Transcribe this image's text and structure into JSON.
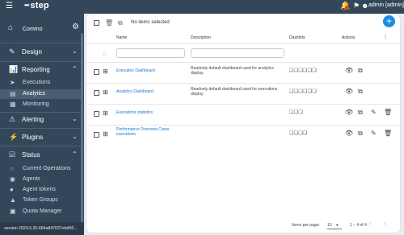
{
  "topbar": {
    "menu_icon": "menu-icon",
    "logo_dots": "•••",
    "logo_text": "step",
    "user_label": "admin [admin]"
  },
  "sidebar": {
    "project_label": "Commo",
    "sections": {
      "design": "Design",
      "reporting": "Reporting",
      "alerting": "Alerting",
      "plugins": "Plugins",
      "status": "Status"
    },
    "reporting_items": [
      "Executions",
      "Analytics",
      "Monitoring"
    ],
    "status_items": [
      "Current Operations",
      "Agents",
      "Agent tokens",
      "Token Groups",
      "Quota Manager"
    ],
    "version": "version 2024.5.20-664a847037efaf66..."
  },
  "toolbar": {
    "selection_text": "No items selected",
    "add_label": "+"
  },
  "table": {
    "headers": {
      "name": "Name",
      "description": "Description",
      "dashlets": "Dashlets",
      "actions": "Actions"
    },
    "rows": [
      {
        "name": "Execution Dashboard",
        "description": "Readonly default dashboard used for analytics display",
        "dashlets": "❑❑❑❑❑❑",
        "editable": false
      },
      {
        "name": "Analytics Dashboard",
        "description": "Readonly default dashboard used for executions display",
        "dashlets": "❑❑❑❑❑❑",
        "editable": false
      },
      {
        "name": "Executions statistics",
        "description": "",
        "dashlets": "❑❑❑",
        "editable": true
      },
      {
        "name": "Performance Overview Cross executions",
        "description": "",
        "dashlets": "❑❑❑❑",
        "editable": true
      }
    ]
  },
  "pagination": {
    "items_per_page_label": "Items per page:",
    "items_per_page_value": "10",
    "range": "1 – 4 of 4"
  },
  "colors": {
    "sidebar_bg": "#34475a",
    "accent": "#1a8fe0",
    "link": "#1a73c8",
    "badge": "#e53935"
  }
}
